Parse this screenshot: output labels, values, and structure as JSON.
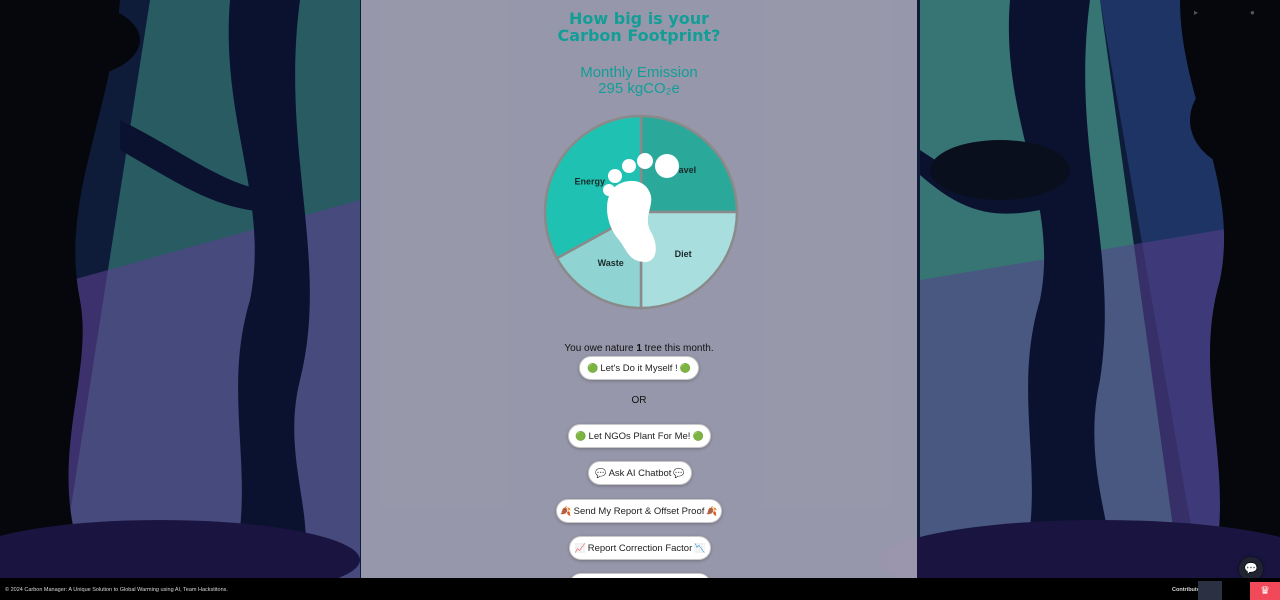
{
  "header": {
    "title_line1": "How big is your",
    "title_line2": "Carbon Footprint?"
  },
  "emission": {
    "label": "Monthly Emission",
    "value": "295 kgCO₂e"
  },
  "chart_data": {
    "type": "pie",
    "categories": [
      "Travel",
      "Diet",
      "Waste",
      "Energy"
    ],
    "values": [
      25,
      25,
      17,
      33
    ],
    "colors": [
      "#2aa89a",
      "#a9dede",
      "#8fd3d3",
      "#1fc2b2"
    ]
  },
  "trees": {
    "prefix": "You owe nature",
    "count": "1",
    "suffix": "tree this month."
  },
  "buttons": {
    "do_it_myself": "Let's Do it Myself !",
    "or_label": "OR",
    "ngo_plant": "Let NGOs Plant For Me!",
    "ask_ai": "Ask AI Chatbot",
    "send_report": "Send My Report & Offset Proof",
    "report_correction": "Report Correction Factor"
  },
  "icons": {
    "leaf": "🟢",
    "chat": "💬",
    "leaves": "🍂",
    "chart_up": "📈",
    "chart_down": "📉"
  },
  "footer": {
    "copyright": "© 2024 Carbon Manager: A Unique Solution to Global Warming using AI, Team Hackstitons.",
    "contributors_label": "Contributors:"
  }
}
